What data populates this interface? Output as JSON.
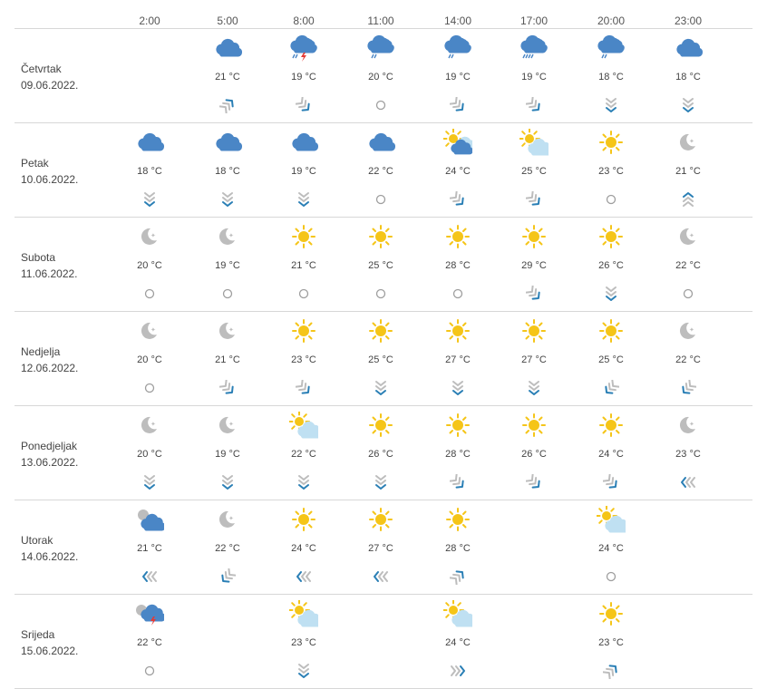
{
  "hours": [
    "2:00",
    "5:00",
    "8:00",
    "11:00",
    "14:00",
    "17:00",
    "20:00",
    "23:00"
  ],
  "days": [
    {
      "name": "Četvrtak",
      "date": "09.06.2022.",
      "cells": [
        null,
        {
          "icon": "cloud",
          "temp": "21 °C",
          "wind": "sw"
        },
        {
          "icon": "storm",
          "temp": "19 °C",
          "wind": "nw"
        },
        {
          "icon": "rain-cloud",
          "temp": "20 °C",
          "wind": "calm"
        },
        {
          "icon": "rain-cloud",
          "temp": "19 °C",
          "wind": "nw"
        },
        {
          "icon": "heavy-rain-cloud",
          "temp": "19 °C",
          "wind": "nw"
        },
        {
          "icon": "rain-cloud",
          "temp": "18 °C",
          "wind": "n"
        },
        {
          "icon": "cloud",
          "temp": "18 °C",
          "wind": "n"
        }
      ]
    },
    {
      "name": "Petak",
      "date": "10.06.2022.",
      "cells": [
        {
          "icon": "cloud",
          "temp": "18 °C",
          "wind": "n"
        },
        {
          "icon": "cloud",
          "temp": "18 °C",
          "wind": "n"
        },
        {
          "icon": "cloud",
          "temp": "19 °C",
          "wind": "n"
        },
        {
          "icon": "cloud",
          "temp": "22 °C",
          "wind": "calm"
        },
        {
          "icon": "sun-cloud",
          "temp": "24 °C",
          "wind": "nw"
        },
        {
          "icon": "sun-light-cloud",
          "temp": "25 °C",
          "wind": "nw"
        },
        {
          "icon": "sun",
          "temp": "23 °C",
          "wind": "calm"
        },
        {
          "icon": "moon",
          "temp": "21 °C",
          "wind": "s"
        }
      ]
    },
    {
      "name": "Subota",
      "date": "11.06.2022.",
      "cells": [
        {
          "icon": "moon",
          "temp": "20 °C",
          "wind": "calm"
        },
        {
          "icon": "moon",
          "temp": "19 °C",
          "wind": "calm"
        },
        {
          "icon": "sun",
          "temp": "21 °C",
          "wind": "calm"
        },
        {
          "icon": "sun",
          "temp": "25 °C",
          "wind": "calm"
        },
        {
          "icon": "sun",
          "temp": "28 °C",
          "wind": "calm"
        },
        {
          "icon": "sun",
          "temp": "29 °C",
          "wind": "nw"
        },
        {
          "icon": "sun",
          "temp": "26 °C",
          "wind": "n"
        },
        {
          "icon": "moon",
          "temp": "22 °C",
          "wind": "calm"
        }
      ]
    },
    {
      "name": "Nedjelja",
      "date": "12.06.2022.",
      "cells": [
        {
          "icon": "moon",
          "temp": "20 °C",
          "wind": "calm"
        },
        {
          "icon": "moon",
          "temp": "21 °C",
          "wind": "nw"
        },
        {
          "icon": "sun",
          "temp": "23 °C",
          "wind": "nw"
        },
        {
          "icon": "sun",
          "temp": "25 °C",
          "wind": "n"
        },
        {
          "icon": "sun",
          "temp": "27 °C",
          "wind": "n"
        },
        {
          "icon": "sun",
          "temp": "27 °C",
          "wind": "n"
        },
        {
          "icon": "sun",
          "temp": "25 °C",
          "wind": "ne"
        },
        {
          "icon": "moon",
          "temp": "22 °C",
          "wind": "ne"
        }
      ]
    },
    {
      "name": "Ponedjeljak",
      "date": "13.06.2022.",
      "cells": [
        {
          "icon": "moon",
          "temp": "20 °C",
          "wind": "n"
        },
        {
          "icon": "moon",
          "temp": "19 °C",
          "wind": "n"
        },
        {
          "icon": "sun-light-cloud",
          "temp": "22 °C",
          "wind": "n"
        },
        {
          "icon": "sun",
          "temp": "26 °C",
          "wind": "n"
        },
        {
          "icon": "sun",
          "temp": "28 °C",
          "wind": "nw"
        },
        {
          "icon": "sun",
          "temp": "26 °C",
          "wind": "nw"
        },
        {
          "icon": "sun",
          "temp": "24 °C",
          "wind": "nw"
        },
        {
          "icon": "moon",
          "temp": "23 °C",
          "wind": "e"
        }
      ]
    },
    {
      "name": "Utorak",
      "date": "14.06.2022.",
      "cells": [
        {
          "icon": "moon-cloud",
          "temp": "21 °C",
          "wind": "e"
        },
        {
          "icon": "moon",
          "temp": "22 °C",
          "wind": "ne"
        },
        {
          "icon": "sun",
          "temp": "24 °C",
          "wind": "e"
        },
        {
          "icon": "sun",
          "temp": "27 °C",
          "wind": "e"
        },
        {
          "icon": "sun",
          "temp": "28 °C",
          "wind": "sw"
        },
        null,
        {
          "icon": "sun-light-cloud",
          "temp": "24 °C",
          "wind": "calm"
        },
        null
      ]
    },
    {
      "name": "Srijeda",
      "date": "15.06.2022.",
      "cells": [
        {
          "icon": "moon-storm",
          "temp": "22 °C",
          "wind": "calm"
        },
        null,
        {
          "icon": "sun-light-cloud",
          "temp": "23 °C",
          "wind": "n"
        },
        null,
        {
          "icon": "sun-light-cloud",
          "temp": "24 °C",
          "wind": "w"
        },
        null,
        {
          "icon": "sun",
          "temp": "23 °C",
          "wind": "sw"
        },
        null
      ]
    }
  ],
  "colors": {
    "cloud": "#4a86c6",
    "sun": "#f5c518",
    "moon": "#bdbdbd",
    "wind_dark": "#2a7fb5",
    "wind_light": "#bdbdbd",
    "lightning": "#e53935",
    "rain": "#4a86c6",
    "light_cloud": "#bfe0f2"
  }
}
